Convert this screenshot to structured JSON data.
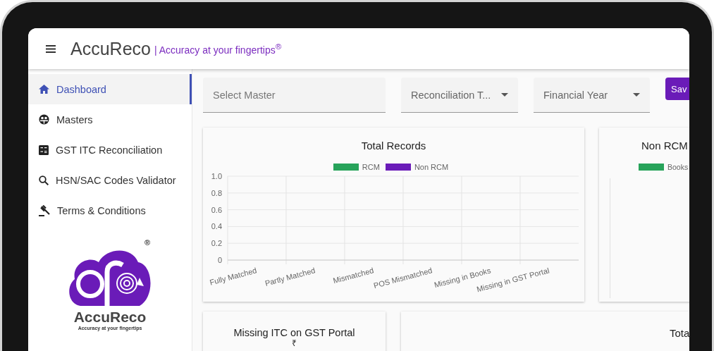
{
  "header": {
    "brand": "AccuReco",
    "tagline": "| Accuracy at your fingertips$^{®}$"
  },
  "sidebar": {
    "items": [
      {
        "label": "Dashboard",
        "selected": true
      },
      {
        "label": "Masters",
        "selected": false
      },
      {
        "label": "GST ITC Reconciliation",
        "selected": false
      },
      {
        "label": "HSN/SAC Codes Validator",
        "selected": false
      },
      {
        "label": "Terms & Conditions",
        "selected": false
      }
    ],
    "logo": {
      "name": "AccuReco",
      "tagline": "Accuracy at your fingertips",
      "mark": "®"
    }
  },
  "filters": {
    "master": {
      "placeholder": "Select Master"
    },
    "reconciliation_type": {
      "value": "Reconciliation T..."
    },
    "financial_year": {
      "value": "Financial Year"
    },
    "save_button": "Sav"
  },
  "cards": [
    {
      "kind": "chart",
      "chart_data": {
        "type": "bar",
        "title": "Total Records",
        "categories": [
          "Fully Matched",
          "Partly Matched",
          "Mismatched",
          "POS Mismatched",
          "Missing in Books",
          "Missing in GST Portal"
        ],
        "series": [
          {
            "name": "RCM",
            "color": "#27a35a",
            "values": [
              null,
              null,
              null,
              null,
              null,
              null
            ]
          },
          {
            "name": "Non RCM",
            "color": "#6a1bb8",
            "values": [
              null,
              null,
              null,
              null,
              null,
              null
            ]
          }
        ],
        "grid": true,
        "ylim": [
          0,
          1
        ],
        "yticks": [
          0,
          0.2,
          0.4,
          0.6,
          0.8,
          {
            "value": 1,
            "label": "1.0"
          }
        ]
      }
    },
    {
      "kind": "partial",
      "title": "Non RCM",
      "legend": [
        {
          "label": "Books",
          "color": "#27a35a"
        }
      ]
    }
  ],
  "bottom_cards": [
    {
      "title": "Missing ITC on GST Portal",
      "value": "₹"
    },
    {
      "title": "Tota"
    }
  ]
}
